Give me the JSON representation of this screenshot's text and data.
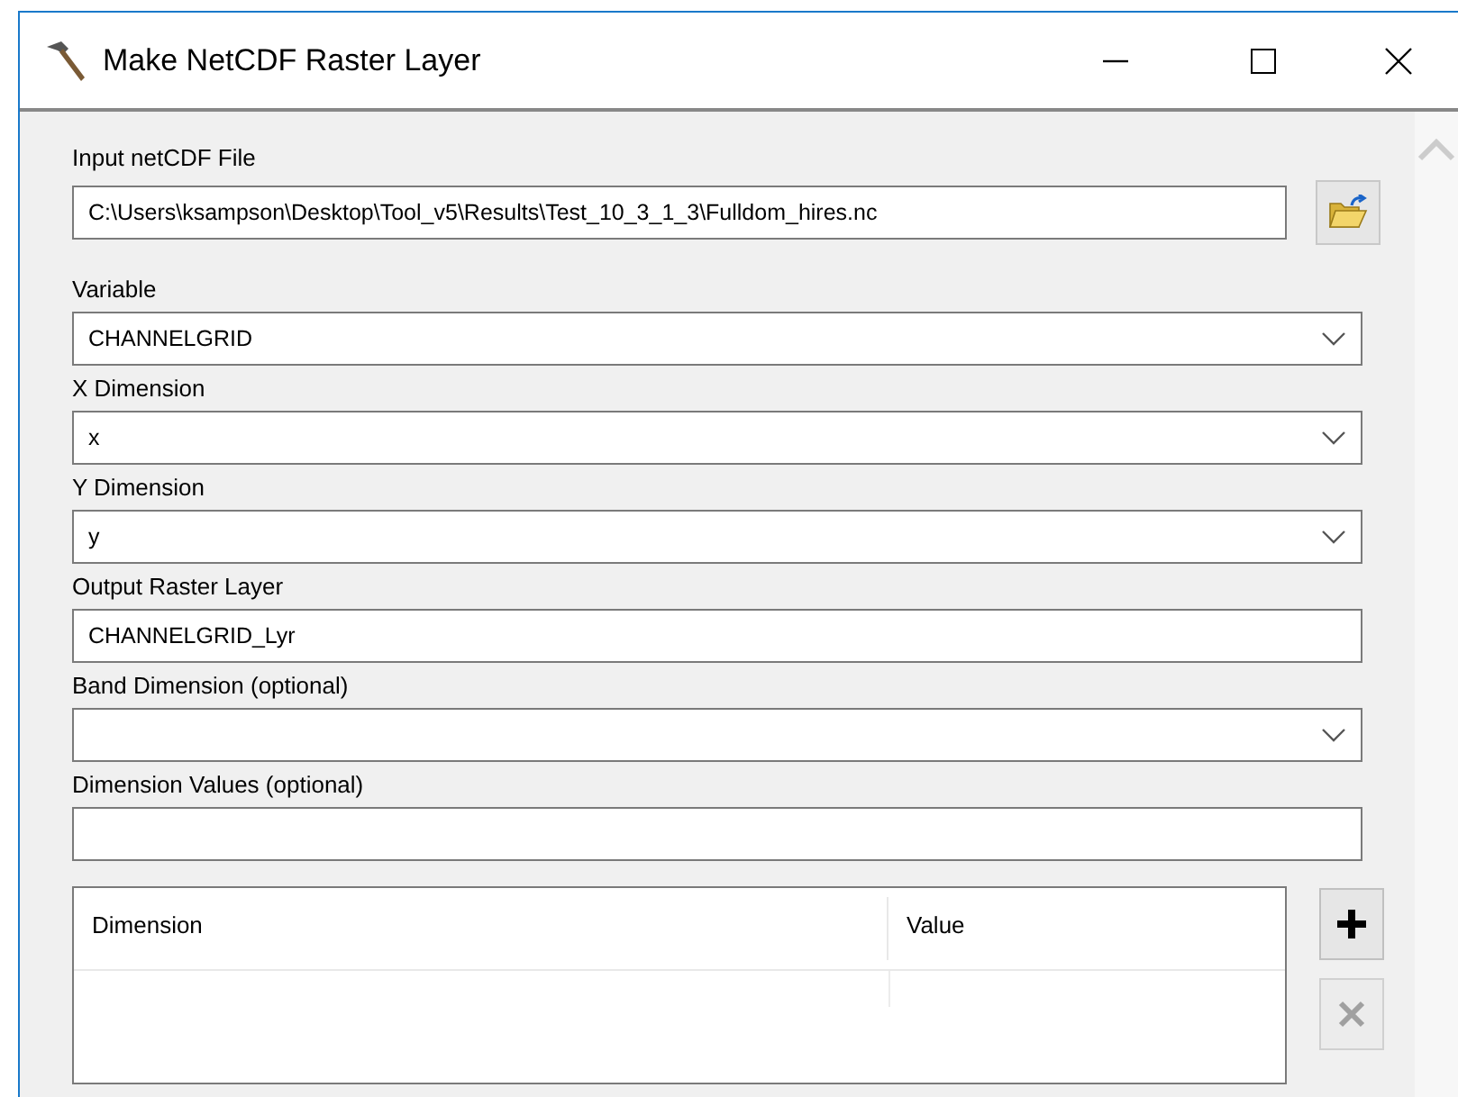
{
  "window": {
    "title": "Make NetCDF Raster Layer"
  },
  "params": [
    {
      "label": "Input netCDF File",
      "kind": "file",
      "value": "C:\\Users\\ksampson\\Desktop\\Tool_v5\\Results\\Test_10_3_1_3\\Fulldom_hires.nc"
    },
    {
      "label": "Variable",
      "kind": "dropdown",
      "value": "CHANNELGRID"
    },
    {
      "label": "X Dimension",
      "kind": "dropdown",
      "value": "x"
    },
    {
      "label": "Y Dimension",
      "kind": "dropdown",
      "value": "y"
    },
    {
      "label": "Output Raster Layer",
      "kind": "text",
      "value": "CHANNELGRID_Lyr"
    },
    {
      "label": "Band Dimension (optional)",
      "kind": "dropdown"
    },
    {
      "label": "Dimension Values (optional)",
      "kind": "text"
    }
  ],
  "table": {
    "columns": [
      "Dimension",
      "Value"
    ]
  },
  "table_buttons": [
    {
      "kind": "add",
      "disabled": false
    },
    {
      "kind": "remove",
      "disabled": true
    }
  ]
}
